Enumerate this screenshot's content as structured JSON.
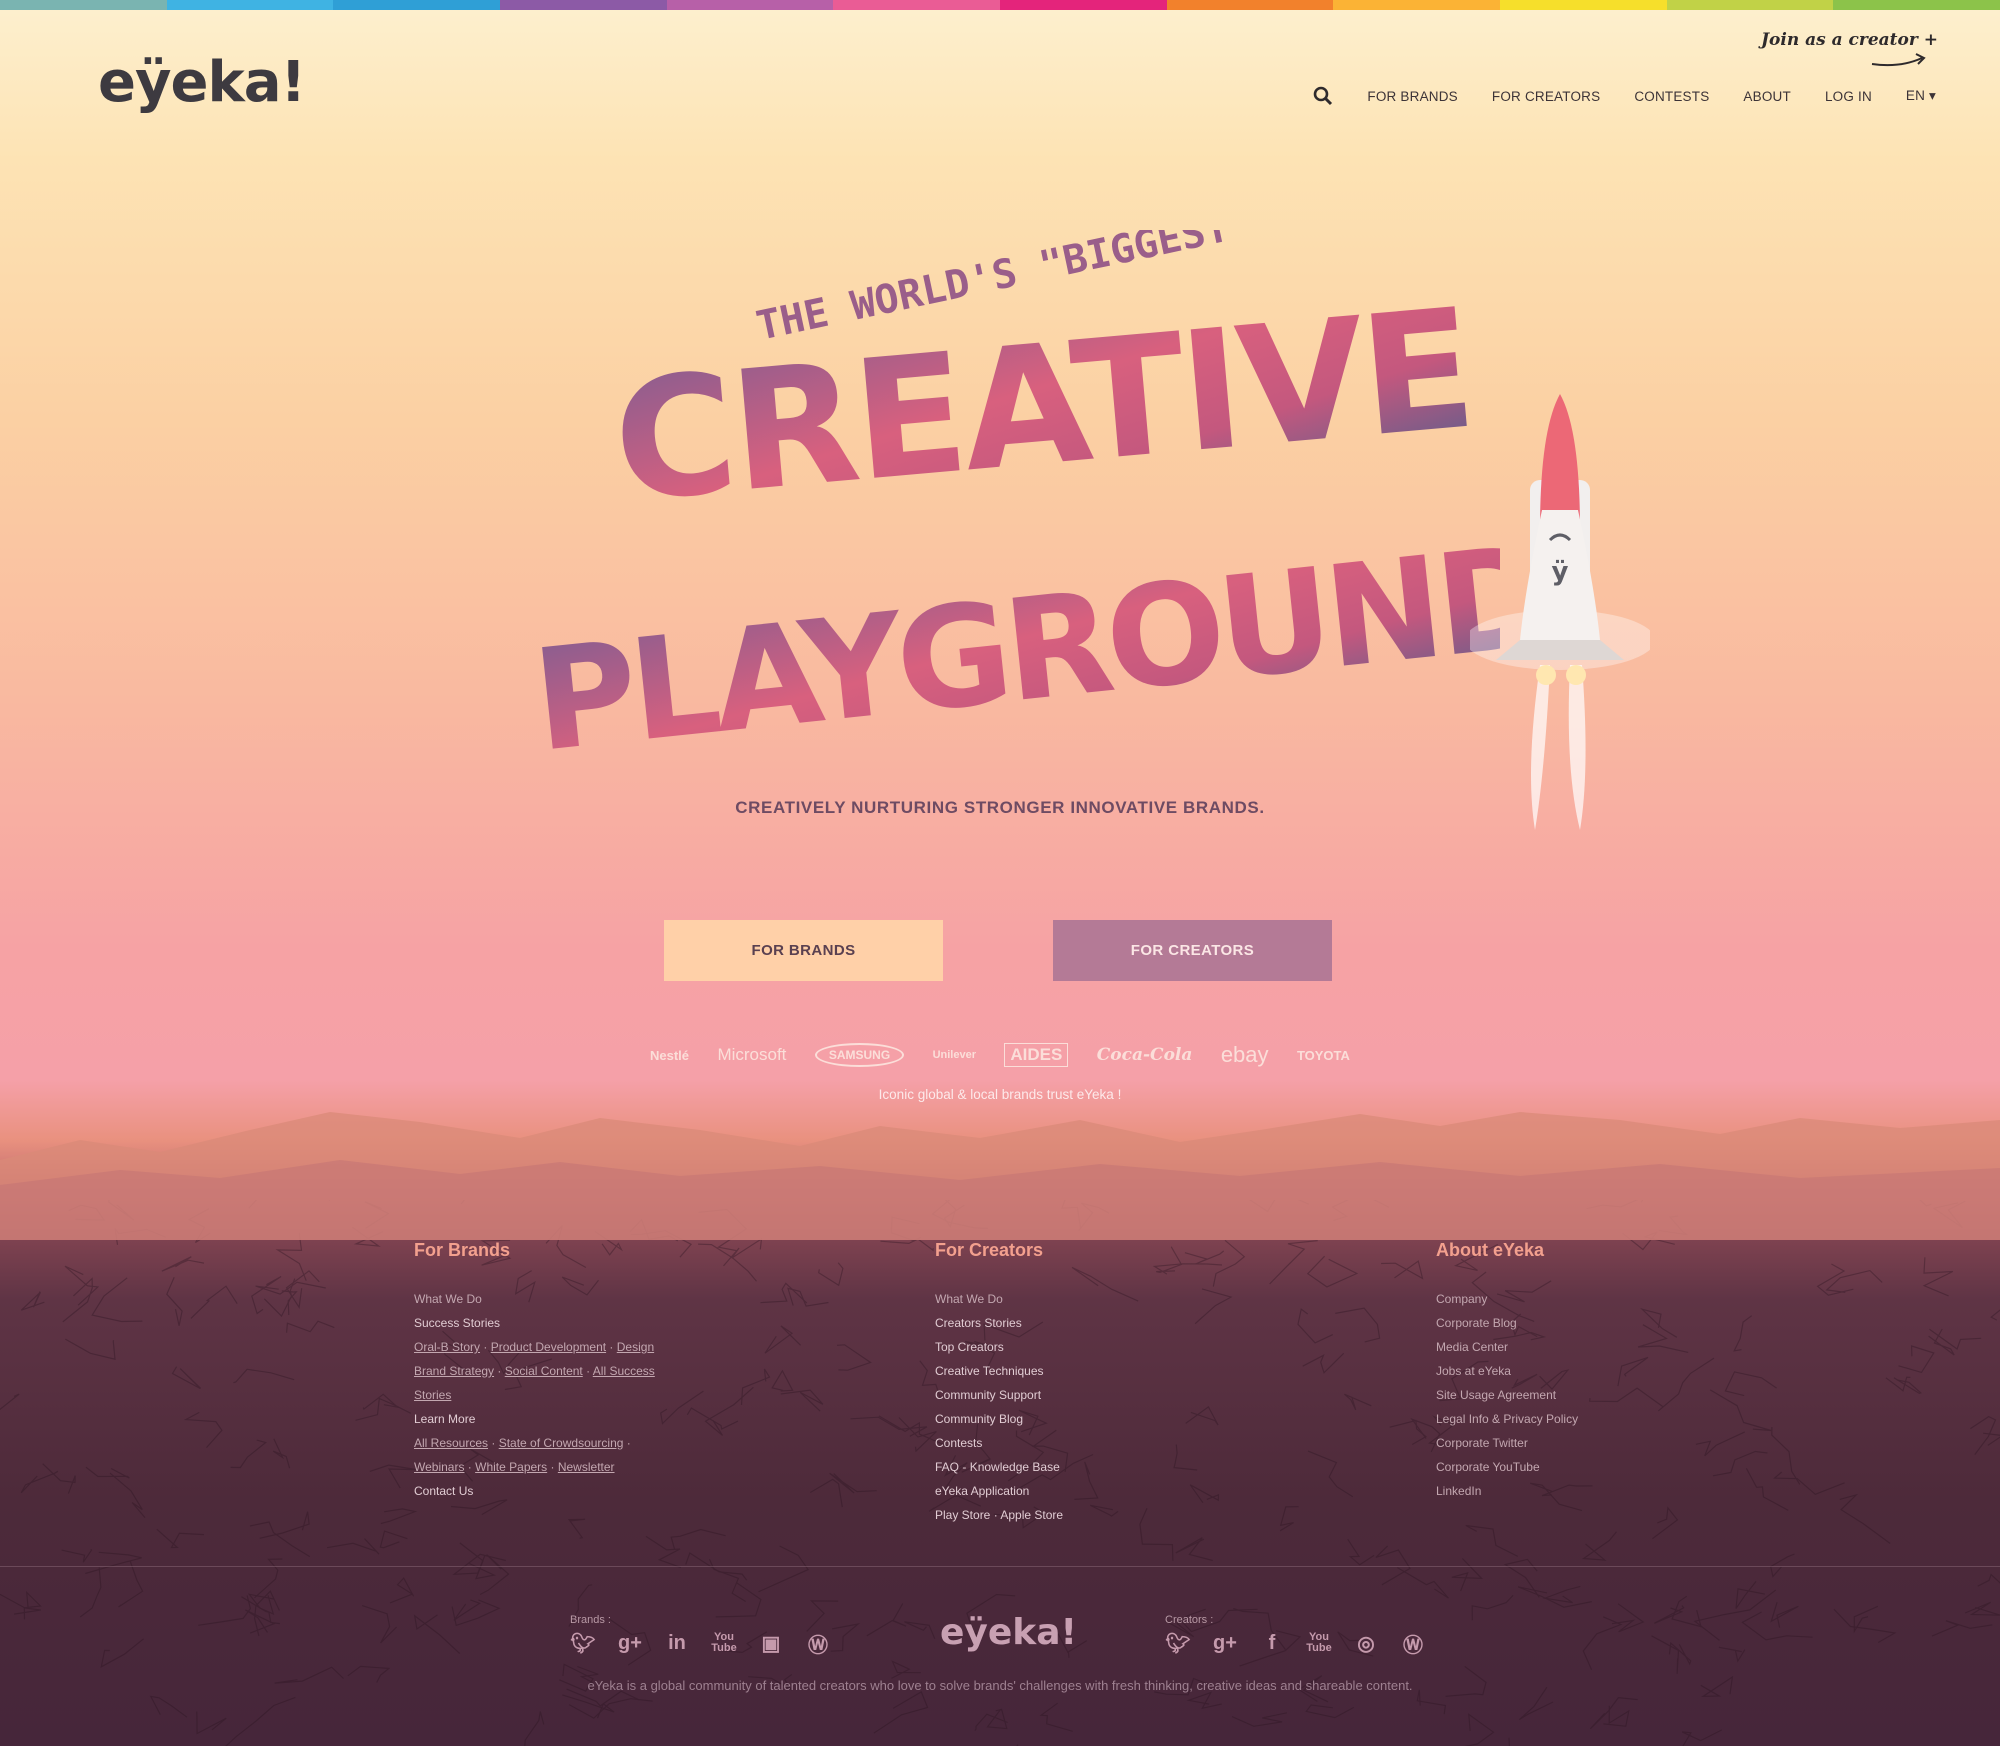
{
  "stripes": [
    "#7ab4b1",
    "#3fb3e3",
    "#2f9fd6",
    "#8c5aa6",
    "#b760a8",
    "#ea5c95",
    "#e4247b",
    "#f2812c",
    "#fbb335",
    "#f6df2b",
    "#c1d247",
    "#8cc34a"
  ],
  "header": {
    "logo": "eÿeka!",
    "join_label": "Join as a creator +",
    "nav": {
      "for_brands": "FOR BRANDS",
      "for_creators": "FOR CREATORS",
      "contests": "CONTESTS",
      "about": "ABOUT",
      "log_in": "LOG IN",
      "language": "EN ▾"
    }
  },
  "hero": {
    "kicker": "THE WORLD'S \"BIGGEST\"",
    "line1": "CREATIVE",
    "line2": "PLAYGROUND",
    "tagline": "CREATIVELY NURTURING STRONGER INNOVATIVE BRANDS.",
    "cta_brands": "FOR BRANDS",
    "cta_creators": "FOR CREATORS",
    "brands": [
      "Nestlé",
      "Microsoft",
      "SAMSUNG",
      "Unilever",
      "AIDES",
      "Coca-Cola",
      "ebay",
      "TOYOTA"
    ],
    "trust_text": "Iconic global & local brands trust eYeka !"
  },
  "footer": {
    "for_brands": {
      "title": "For Brands",
      "what_we_do": "What We Do",
      "success_stories": "Success Stories",
      "oral_b": "Oral-B Story",
      "product_dev": "Product Development",
      "design": "Design",
      "brand_strategy": "Brand Strategy",
      "social_content": "Social Content",
      "all_success": "All Success",
      "stories": "Stories",
      "learn_more": "Learn More",
      "all_resources": "All Resources",
      "state_crowd": "State of Crowdsourcing",
      "webinars": "Webinars",
      "white_papers": "White Papers",
      "newsletter": "Newsletter",
      "contact": "Contact Us"
    },
    "for_creators": {
      "title": "For Creators",
      "items": [
        "What We Do",
        "Creators Stories",
        "Top Creators",
        "Creative Techniques",
        "Community Support",
        "Community Blog",
        "Contests"
      ],
      "faq": "FAQ",
      "kb": "Knowledge Base",
      "app": "eYeka Application",
      "play": "Play Store",
      "apple": "Apple Store"
    },
    "about": {
      "title": "About eYeka",
      "items": [
        "Company",
        "Corporate Blog",
        "Media Center",
        "Jobs at eYeka",
        "Site Usage Agreement",
        "Legal Info & Privacy Policy",
        "Corporate Twitter",
        "Corporate YouTube",
        "LinkedIn"
      ]
    },
    "brands_label": "Brands :",
    "creators_label": "Creators :",
    "brand_icons": [
      "twitter-icon",
      "google-plus-icon",
      "linkedin-icon",
      "youtube-icon",
      "slideshare-icon",
      "wordpress-icon"
    ],
    "creator_icons": [
      "twitter-icon",
      "google-plus-icon",
      "facebook-icon",
      "youtube-icon",
      "instagram-icon",
      "wordpress-icon"
    ],
    "logo": "eÿeka!",
    "description": "eYeka is a global community of talented creators who love to solve brands' challenges with fresh thinking, creative ideas and shareable content."
  }
}
